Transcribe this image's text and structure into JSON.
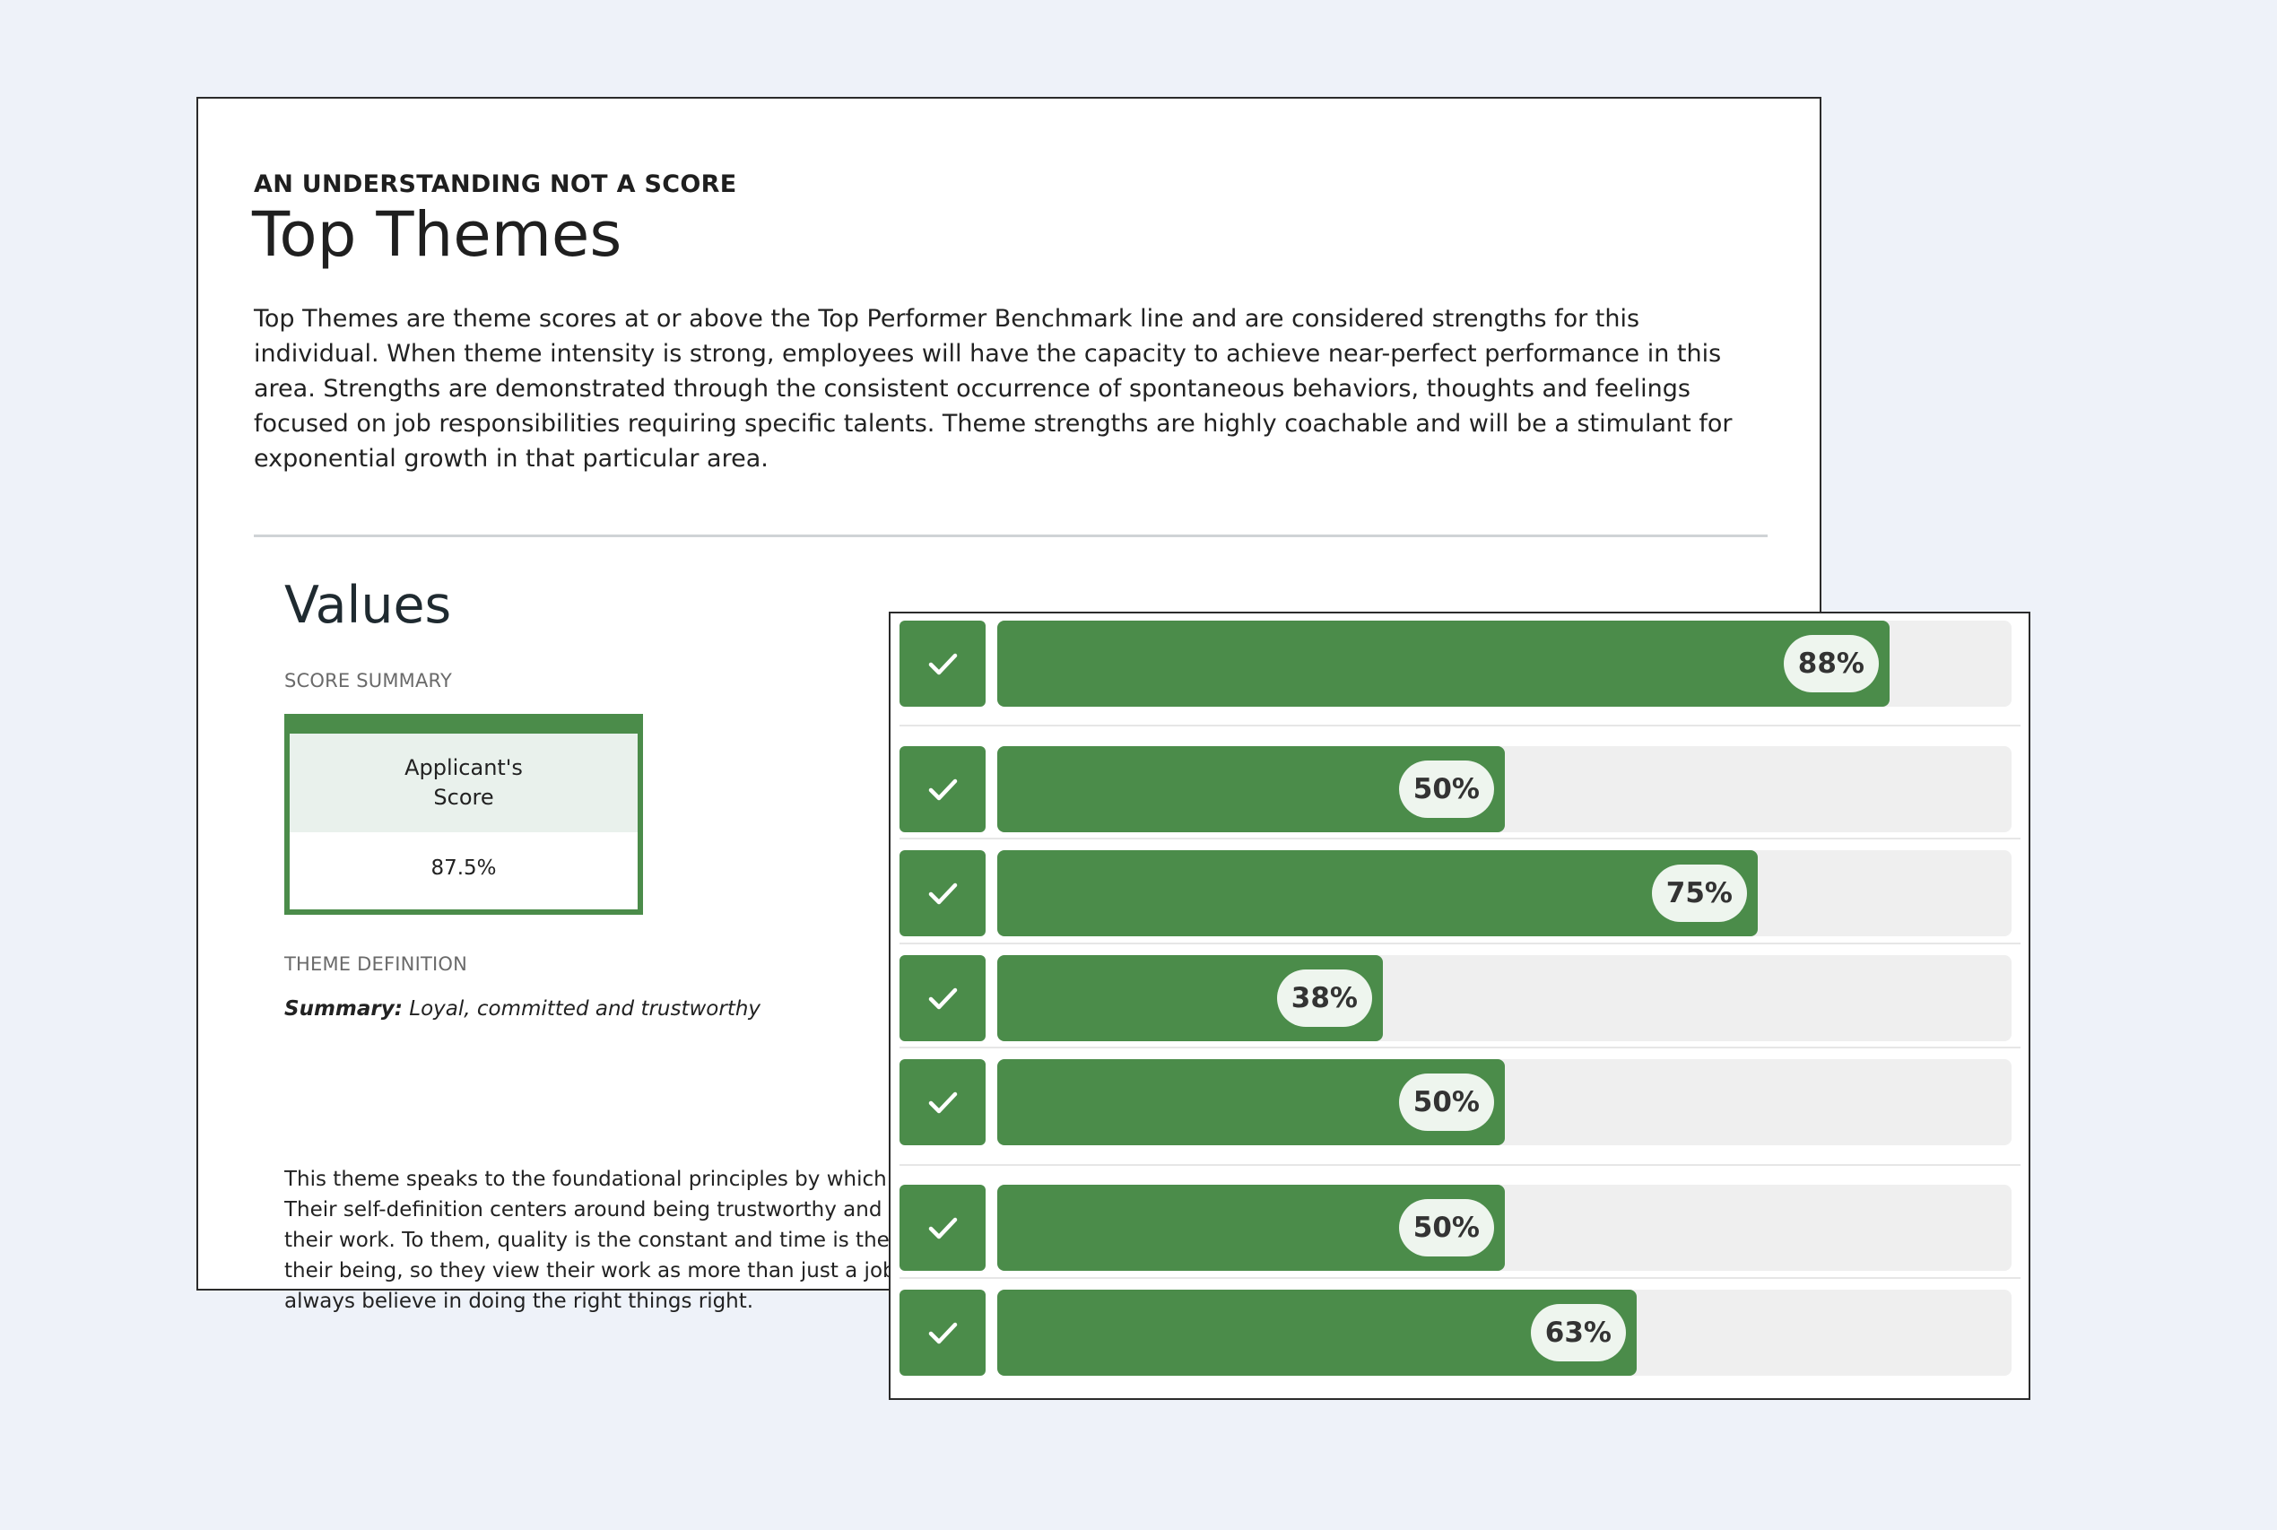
{
  "report": {
    "eyebrow": "AN UNDERSTANDING NOT A SCORE",
    "title": "Top Themes",
    "intro": "Top Themes are theme scores at or above the Top Performer Benchmark line and are considered strengths for this individual. When theme intensity is strong, employees will have the capacity to achieve near-perfect performance in this area. Strengths are demonstrated through the consistent occurrence of spontaneous behaviors, thoughts and feelings focused on job responsibilities requiring specific talents. Theme strengths are highly coachable and will be a stimulant for exponential growth in that particular area.",
    "section_title": "Values",
    "score_summary_label": "SCORE SUMMARY",
    "score_box": {
      "header": "Applicant's Score",
      "value": "87.5%"
    },
    "theme_definition_label": "THEME DEFINITION",
    "summary_label": "Summary:",
    "summary_text": " Loyal, committed and trustworthy",
    "definition_lines": [
      "This theme speaks to the foundational principles by which th",
      "Their self-definition centers around being trustworthy and th",
      "their work. To them, quality is the constant and time is the va",
      "their being, so they view their work as more than just a job. T",
      "always believe in doing the right things right."
    ]
  },
  "bars": [
    {
      "label": "88%",
      "value": 88
    },
    {
      "label": "50%",
      "value": 50
    },
    {
      "label": "75%",
      "value": 75
    },
    {
      "label": "38%",
      "value": 38
    },
    {
      "label": "50%",
      "value": 50
    },
    {
      "label": "50%",
      "value": 50
    },
    {
      "label": "63%",
      "value": 63
    }
  ],
  "colors": {
    "accent_green": "#4b8c4a",
    "track_gray": "#efefef",
    "background": "#eef2f9"
  },
  "icons": {
    "row_check": "check-icon"
  }
}
